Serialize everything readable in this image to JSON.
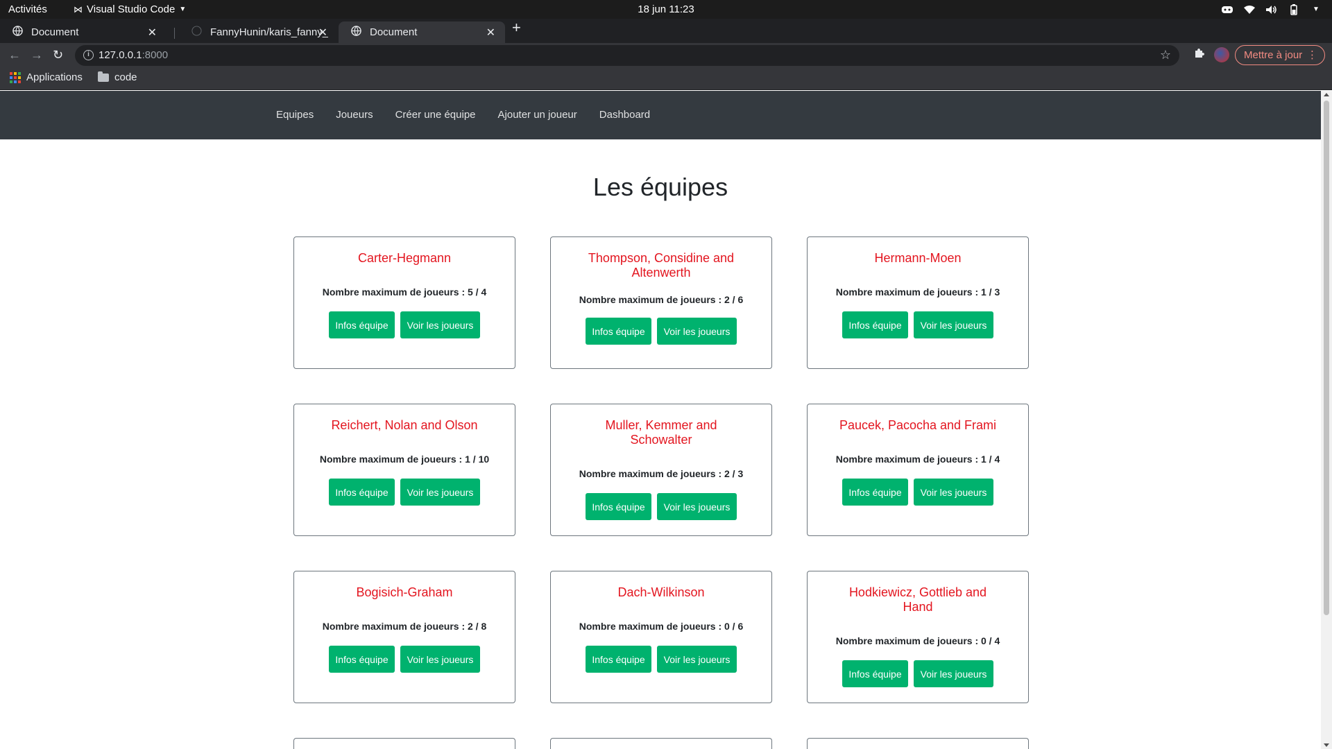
{
  "desktop": {
    "activities_label": "Activités",
    "app_name": "Visual Studio Code",
    "clock": "18 jun  11:23"
  },
  "browser": {
    "tabs": [
      {
        "title": "Document",
        "active": false
      },
      {
        "title": "FannyHunin/karis_fanny_",
        "active": false
      },
      {
        "title": "Document",
        "active": true
      }
    ],
    "url_host": "127.0.0.1",
    "url_port": ":8000",
    "update_button": "Mettre à jour",
    "bookmarks": [
      "Applications",
      "code"
    ]
  },
  "site": {
    "nav": [
      "Equipes",
      "Joueurs",
      "Créer une équipe",
      "Ajouter un joueur",
      "Dashboard"
    ],
    "page_title": "Les équipes",
    "info_button": "Infos équipe",
    "players_button": "Voir les joueurs",
    "teams": [
      {
        "name": "Carter-Hegmann",
        "players": "Nombre maximum de joueurs : 5 / 4"
      },
      {
        "name": "Thompson, Considine and Altenwerth",
        "players": "Nombre maximum de joueurs : 2 / 6"
      },
      {
        "name": "Hermann-Moen",
        "players": "Nombre maximum de joueurs : 1 / 3"
      },
      {
        "name": "Reichert, Nolan and Olson",
        "players": "Nombre maximum de joueurs : 1 / 10"
      },
      {
        "name": "Muller, Kemmer and Schowalter",
        "players": "Nombre maximum de joueurs : 2 / 3"
      },
      {
        "name": "Paucek, Pacocha and Frami",
        "players": "Nombre maximum de joueurs : 1 / 4"
      },
      {
        "name": "Bogisich-Graham",
        "players": "Nombre maximum de joueurs : 2 / 8"
      },
      {
        "name": "Dach-Wilkinson",
        "players": "Nombre maximum de joueurs : 0 / 6"
      },
      {
        "name": "Hodkiewicz, Gottlieb and Hand",
        "players": "Nombre maximum de joueurs : 0 / 4"
      }
    ]
  },
  "colors": {
    "accent_green": "#00b26e",
    "team_red": "#e3151f",
    "navbar": "#343a40"
  }
}
